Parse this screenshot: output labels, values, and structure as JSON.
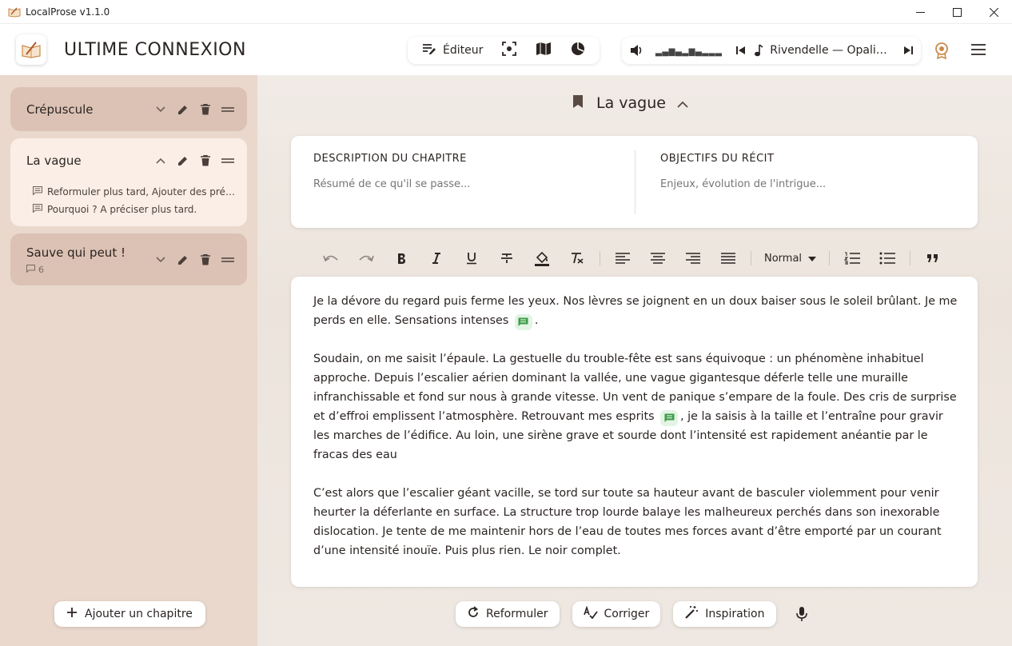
{
  "window": {
    "title": "LocalProse v1.1.0"
  },
  "header": {
    "book_title": "ULTIME CONNEXION",
    "modes": [
      {
        "label": "Éditeur",
        "icon": "editor-icon"
      },
      {
        "label": "",
        "icon": "focus-icon"
      },
      {
        "label": "",
        "icon": "map-icon"
      },
      {
        "label": "",
        "icon": "stats-pie-icon"
      }
    ],
    "player": {
      "waveform": "▂▃▅▃▂▅▃▂▂▂",
      "track": "Rivendelle — Opaline Nocturne"
    }
  },
  "sidebar": {
    "chapters": [
      {
        "title": "Crépuscule",
        "expanded": false
      },
      {
        "title": "La vague",
        "expanded": true,
        "notes": [
          "Reformuler plus tard, Ajouter des précisions",
          "Pourquoi ? A préciser plus tard."
        ]
      },
      {
        "title": "Sauve qui peut !",
        "expanded": false,
        "note_count": "6"
      }
    ],
    "add_label": "Ajouter un chapitre"
  },
  "main": {
    "chapter_title": "La vague",
    "description": {
      "label": "DESCRIPTION DU CHAPITRE",
      "placeholder": "Résumé de ce qu'il se passe..."
    },
    "objectives": {
      "label": "OBJECTIFS DU RÉCIT",
      "placeholder": "Enjeux, évolution de l'intrigue..."
    },
    "toolbar": {
      "style_select": "Normal"
    },
    "editor": {
      "p1a": "Je la dévore du regard puis ferme les yeux. Nos lèvres se joignent en un doux baiser sous le soleil brûlant. Je me perds en elle. Sensations intenses",
      "p1b": ".",
      "p2a": "Soudain, on me saisit l’épaule. La gestuelle du trouble-fête est sans équivoque : un phénomène inhabituel approche. Depuis l’escalier aérien dominant la vallée, une vague gigantesque déferle telle une muraille infranchissable et fond sur nous à grande vitesse. Un vent de panique s’empare de la foule. Des cris de surprise et d’effroi emplissent l’atmosphère. Retrouvant mes esprits",
      "p2b": ", je la saisis à la taille et l’entraîne pour gravir les marches de l’édifice. Au loin, une sirène grave et sourde dont l’intensité est rapidement anéantie par le fracas des eau",
      "p3": "C’est alors que l’escalier géant vacille, se tord sur toute sa hauteur avant de basculer violemment pour venir heurter la déferlante en surface. La structure trop lourde balaye les malheureux perchés dans son inexorable dislocation. Je tente de me maintenir hors de l’eau de toutes mes forces avant d’être emporté par un courant d’une intensité inouïe. Puis plus rien. Le noir complet."
    },
    "actions": [
      {
        "label": "Reformuler",
        "icon": "refresh-icon"
      },
      {
        "label": "Corriger",
        "icon": "spellcheck-icon"
      },
      {
        "label": "Inspiration",
        "icon": "magic-wand-icon"
      }
    ]
  },
  "colors": {
    "sidebar_bg": "#ead8cd",
    "chapter_bg": "#dcc2b4",
    "chapter_active_bg": "#fbeee6",
    "comment_green": "#3b9b47"
  }
}
